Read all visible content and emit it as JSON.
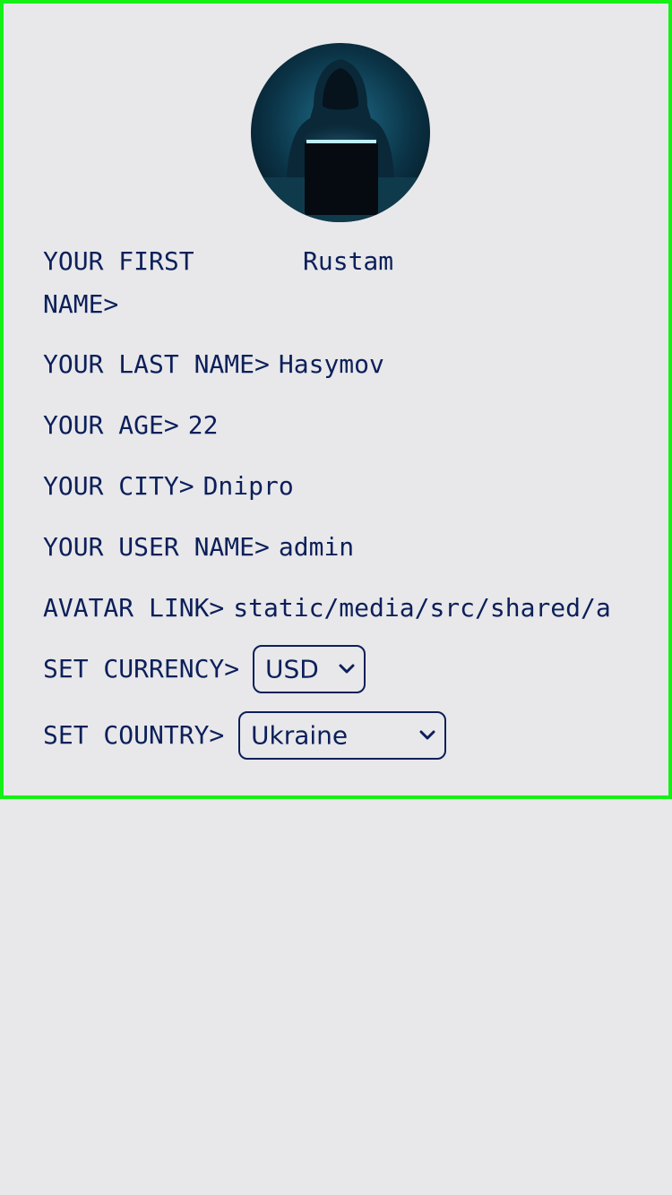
{
  "profile": {
    "avatar_icon": "hooded-hacker-avatar",
    "fields": {
      "first_name_label": "YOUR FIRST NAME>",
      "first_name_value": "Rustam",
      "last_name_label": "YOUR LAST NAME>",
      "last_name_value": "Hasymov",
      "age_label": "YOUR AGE>",
      "age_value": "22",
      "city_label": "YOUR CITY>",
      "city_value": "Dnipro",
      "username_label": "YOUR USER NAME>",
      "username_value": "admin",
      "avatar_link_label": "AVATAR LINK>",
      "avatar_link_value": "static/media/src/shared/a",
      "currency_label": "SET CURRENCY>",
      "currency_selected": "USD",
      "country_label": "SET COUNTRY>",
      "country_selected": "Ukraine"
    }
  },
  "colors": {
    "background": "#e8e8ea",
    "border": "#16f016",
    "text": "#0c1f5a"
  }
}
